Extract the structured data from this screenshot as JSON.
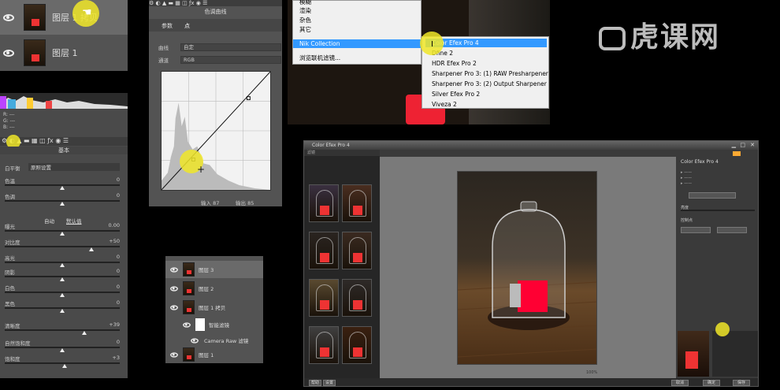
{
  "layers_top": {
    "rows": [
      {
        "name": "图层 1 拷贝"
      },
      {
        "name": "图层 1"
      }
    ]
  },
  "camera_raw": {
    "stats": [
      "---",
      "---",
      "---"
    ],
    "section_title": "基本",
    "white_balance_label": "白平衡",
    "white_balance_value": "原照设置",
    "auto_label": "自动",
    "default_label": "默认值",
    "sliders": [
      {
        "label": "色温",
        "value": "0",
        "pos": 0.5
      },
      {
        "label": "色调",
        "value": "0",
        "pos": 0.5
      },
      {
        "label": "曝光",
        "value": "0.00",
        "pos": 0.5
      },
      {
        "label": "对比度",
        "value": "+50",
        "pos": 0.75
      },
      {
        "label": "高光",
        "value": "0",
        "pos": 0.5
      },
      {
        "label": "阴影",
        "value": "0",
        "pos": 0.5
      },
      {
        "label": "白色",
        "value": "0",
        "pos": 0.5
      },
      {
        "label": "黑色",
        "value": "0",
        "pos": 0.5
      },
      {
        "label": "清晰度",
        "value": "+39",
        "pos": 0.69
      },
      {
        "label": "自然饱和度",
        "value": "0",
        "pos": 0.5
      },
      {
        "label": "饱和度",
        "value": "+3",
        "pos": 0.52
      }
    ]
  },
  "curves": {
    "panel_title": "色调曲线",
    "tabs": [
      "参数",
      "点"
    ],
    "curve_label": "曲线",
    "curve_value": "自定",
    "channel_label": "通道",
    "channel_value": "RGB",
    "input_label": "输入",
    "input_value": "87",
    "output_label": "输出",
    "output_value": "85"
  },
  "menu": {
    "items": [
      "模糊",
      "渲染",
      "杂色",
      "其它",
      "Nik Collection",
      "浏览联机滤镜..."
    ],
    "submenu": [
      "Color Efex Pro 4",
      "Dfine 2",
      "HDR Efex Pro 2",
      "Sharpener Pro 3: (1) RAW Presharpener",
      "Sharpener Pro 3: (2) Output Sharpener",
      "Silver Efex Pro 2",
      "Viveza 2"
    ]
  },
  "watermark": "虎课网",
  "layers_bottom": {
    "rows": [
      "图层 3",
      "图层 2",
      "图层 1 拷贝",
      "智能滤镜",
      "Camera Raw 滤镜",
      "图层 1"
    ]
  },
  "color_efex": {
    "title": "Color Efex Pro 4",
    "panel_title": "Color Efex Pro 4",
    "left_header": "滤镜",
    "right_rows": [
      "亮度",
      "控制点"
    ],
    "bottom_buttons": [
      "帮助",
      "设置",
      "取消",
      "确定",
      "保存"
    ],
    "zoom_label": "100%"
  },
  "colors": {
    "menu_highlight": "#3399ff",
    "panel": "#535353",
    "cursor": "#f0e628",
    "red": "#ee3333"
  }
}
